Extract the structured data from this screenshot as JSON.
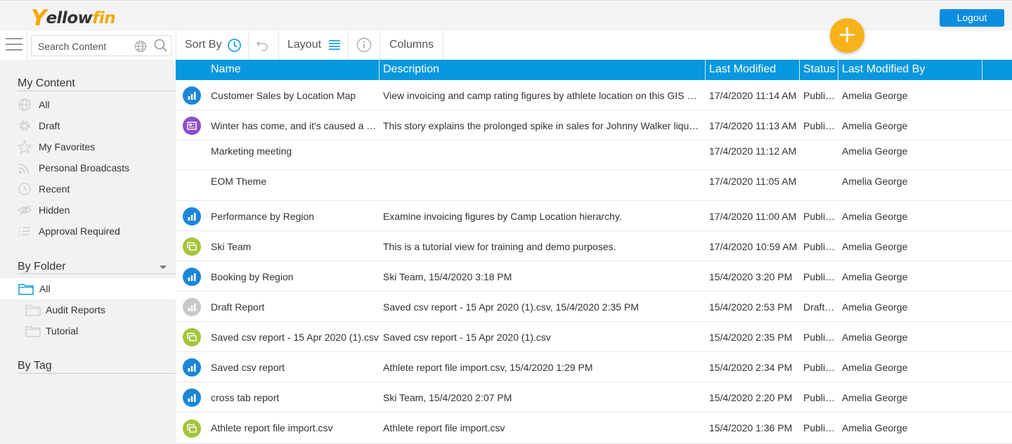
{
  "header": {
    "logo_first": "Y",
    "logo_middle": "ellow",
    "logo_end": "fin",
    "logout_label": "Logout"
  },
  "toolbar": {
    "search_placeholder": "Search Content",
    "sort_label": "Sort By",
    "layout_label": "Layout",
    "columns_label": "Columns",
    "fab_label": "+"
  },
  "sidebar": {
    "my_content_title": "My Content",
    "my_content_items": [
      {
        "label": "All",
        "icon": "globe-icon"
      },
      {
        "label": "Draft",
        "icon": "gear-icon"
      },
      {
        "label": "My Favorites",
        "icon": "star-icon"
      },
      {
        "label": "Personal Broadcasts",
        "icon": "broadcast-icon"
      },
      {
        "label": "Recent",
        "icon": "clock-icon"
      },
      {
        "label": "Hidden",
        "icon": "eye-slash-icon"
      },
      {
        "label": "Approval Required",
        "icon": "checklist-icon"
      }
    ],
    "by_folder_title": "By Folder",
    "folders": [
      {
        "label": "All"
      },
      {
        "label": "Audit Reports"
      },
      {
        "label": "Tutorial"
      }
    ],
    "by_tag_title": "By Tag"
  },
  "table": {
    "columns": [
      "Name",
      "Description",
      "Last Modified",
      "Status",
      "Last Modified By"
    ],
    "rows": [
      {
        "type": "report",
        "name": "Customer Sales by Location Map",
        "description": "View invoicing and camp rating figures by athlete location on this GIS map.",
        "modified": "17/4/2020 11:14 AM",
        "status": "Public Content",
        "by": "Amelia George"
      },
      {
        "type": "story",
        "name": "Winter has come, and it's caused a spike in sales",
        "description": "This story explains the prolonged spike in sales for Johnny Walker liquor products",
        "modified": "17/4/2020 11:13 AM",
        "status": "Public Content",
        "by": "Amelia George"
      },
      {
        "type": "none",
        "name": "Marketing meeting",
        "description": "",
        "modified": "17/4/2020 11:12 AM",
        "status": "",
        "by": "Amelia George"
      },
      {
        "type": "none",
        "name": "EOM Theme",
        "description": "",
        "modified": "17/4/2020 11:05 AM",
        "status": "",
        "by": "Amelia George"
      },
      {
        "type": "report",
        "name": "Performance by Region",
        "description": "Examine invoicing figures by Camp Location hierarchy.",
        "modified": "17/4/2020 11:00 AM",
        "status": "Public Content",
        "by": "Amelia George"
      },
      {
        "type": "view",
        "name": "Ski Team",
        "description": "This is a tutorial view for training and demo purposes.",
        "modified": "17/4/2020 10:59 AM",
        "status": "Public Content",
        "by": "Amelia George"
      },
      {
        "type": "report",
        "name": "Booking by Region",
        "description": "Ski Team, 15/4/2020 3:18 PM",
        "modified": "15/4/2020 3:20 PM",
        "status": "Public Content",
        "by": "Amelia George"
      },
      {
        "type": "draft",
        "name": "Draft Report",
        "description": "Saved csv report - 15 Apr 2020 (1).csv, 15/4/2020 2:35 PM",
        "modified": "15/4/2020 2:53 PM",
        "status": "Draft Content",
        "by": "Amelia George"
      },
      {
        "type": "view",
        "name": "Saved csv report - 15 Apr 2020 (1).csv",
        "description": "Saved csv report - 15 Apr 2020 (1).csv",
        "modified": "15/4/2020 2:35 PM",
        "status": "Public Content",
        "by": "Amelia George"
      },
      {
        "type": "report",
        "name": "Saved csv report",
        "description": "Athlete report file import.csv, 15/4/2020 1:29 PM",
        "modified": "15/4/2020 2:34 PM",
        "status": "Public Content",
        "by": "Amelia George"
      },
      {
        "type": "report",
        "name": "cross tab report",
        "description": "Ski Team, 15/4/2020 2:07 PM",
        "modified": "15/4/2020 2:20 PM",
        "status": "Public Content",
        "by": "Amelia George"
      },
      {
        "type": "view",
        "name": "Athlete report file import.csv",
        "description": "Athlete report file import.csv",
        "modified": "15/4/2020 1:36 PM",
        "status": "Public Content",
        "by": "Amelia George"
      }
    ]
  },
  "colors": {
    "accent": "#0798e0",
    "logout": "#0b8de0",
    "fab": "#f7b21a",
    "report_icon": "#1b86d8",
    "story_icon": "#8e4fc9",
    "view_icon": "#a6c43a",
    "draft_icon": "#c8c8c8"
  }
}
